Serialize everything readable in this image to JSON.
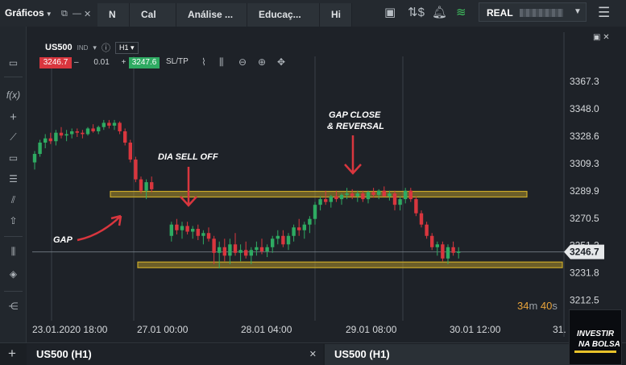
{
  "header": {
    "brand": "Gráficos",
    "tabs": [
      "N",
      "Cal",
      "Análise ...",
      "Educaç...",
      "Hi"
    ],
    "account_mode": "REAL"
  },
  "toolbar": {
    "symbol": "US500",
    "symbol_sub": "IND",
    "timeframe": "H1",
    "sell_price": "3246.7",
    "buy_price": "3247.6",
    "quantity": "0.01",
    "minus": "–",
    "plus": "+",
    "sltp_label": "SL/TP"
  },
  "chart_data": {
    "type": "candlestick",
    "symbol": "US500",
    "timeframe": "H1",
    "y_ticks": [
      3367.3,
      3348.0,
      3328.6,
      3309.3,
      3289.9,
      3270.5,
      3251.2,
      3231.8,
      3212.5
    ],
    "y_tick_labels": [
      "3367.3",
      "3348.0",
      "3328.6",
      "3309.3",
      "3289.9",
      "3270.5",
      "3251.2",
      "3231.8",
      "3212.5"
    ],
    "ylim": [
      3198.0,
      3385.0
    ],
    "current_price": 3246.7,
    "current_price_label": "3246.7",
    "x_labels": [
      "23.01.2020 18:00",
      "27.01 00:00",
      "28.01 04:00",
      "29.01 08:00",
      "30.01 12:00",
      "31."
    ],
    "annotations": [
      "GAP",
      "DIA SELL OFF",
      "GAP CLOSE",
      "& REVERSAL"
    ],
    "zones": [
      {
        "name": "resistance-zone",
        "y": 3287.5
      },
      {
        "name": "support-zone",
        "y": 3237.5
      }
    ],
    "colors": {
      "up": "#2eab62",
      "down": "#d9363e",
      "zone": "#c9a92a",
      "arrow": "#d9363e"
    },
    "candles": [
      [
        3310,
        3318,
        3305,
        3316
      ],
      [
        3316,
        3326,
        3314,
        3324
      ],
      [
        3324,
        3330,
        3320,
        3327
      ],
      [
        3327,
        3331,
        3323,
        3325
      ],
      [
        3325,
        3333,
        3322,
        3331
      ],
      [
        3331,
        3335,
        3327,
        3329
      ],
      [
        3329,
        3333,
        3325,
        3330
      ],
      [
        3330,
        3334,
        3327,
        3332
      ],
      [
        3332,
        3334,
        3328,
        3331
      ],
      [
        3331,
        3333,
        3327,
        3330
      ],
      [
        3330,
        3335,
        3329,
        3334
      ],
      [
        3334,
        3337,
        3331,
        3332
      ],
      [
        3332,
        3336,
        3330,
        3335
      ],
      [
        3335,
        3340,
        3333,
        3338
      ],
      [
        3338,
        3340,
        3334,
        3336
      ],
      [
        3336,
        3340,
        3333,
        3338
      ],
      [
        3338,
        3339,
        3330,
        3332
      ],
      [
        3332,
        3334,
        3322,
        3324
      ],
      [
        3324,
        3326,
        3310,
        3312
      ],
      [
        3312,
        3314,
        3296,
        3298
      ],
      [
        3298,
        3300,
        3288,
        3290
      ],
      [
        3290,
        3298,
        3284,
        3296
      ],
      [
        3296,
        3300,
        3289,
        3291
      ],
      [
        3258,
        3268,
        3254,
        3266
      ],
      [
        3266,
        3270,
        3259,
        3262
      ],
      [
        3262,
        3268,
        3256,
        3265
      ],
      [
        3265,
        3268,
        3259,
        3261
      ],
      [
        3261,
        3265,
        3256,
        3263
      ],
      [
        3263,
        3266,
        3255,
        3258
      ],
      [
        3258,
        3262,
        3252,
        3260
      ],
      [
        3260,
        3264,
        3254,
        3256
      ],
      [
        3256,
        3258,
        3238,
        3246
      ],
      [
        3246,
        3254,
        3235,
        3250
      ],
      [
        3250,
        3256,
        3240,
        3244
      ],
      [
        3244,
        3256,
        3238,
        3252
      ],
      [
        3252,
        3260,
        3244,
        3246
      ],
      [
        3246,
        3252,
        3240,
        3248
      ],
      [
        3248,
        3254,
        3242,
        3244
      ],
      [
        3244,
        3250,
        3238,
        3248
      ],
      [
        3248,
        3254,
        3244,
        3250
      ],
      [
        3250,
        3256,
        3245,
        3247
      ],
      [
        3247,
        3252,
        3243,
        3250
      ],
      [
        3250,
        3258,
        3246,
        3256
      ],
      [
        3256,
        3262,
        3252,
        3258
      ],
      [
        3258,
        3262,
        3250,
        3252
      ],
      [
        3252,
        3260,
        3248,
        3258
      ],
      [
        3258,
        3266,
        3254,
        3264
      ],
      [
        3264,
        3270,
        3258,
        3262
      ],
      [
        3262,
        3268,
        3256,
        3266
      ],
      [
        3266,
        3272,
        3260,
        3270
      ],
      [
        3270,
        3282,
        3266,
        3280
      ],
      [
        3280,
        3286,
        3276,
        3284
      ],
      [
        3284,
        3290,
        3280,
        3282
      ],
      [
        3282,
        3287,
        3278,
        3286
      ],
      [
        3286,
        3290,
        3282,
        3284
      ],
      [
        3284,
        3288,
        3280,
        3287
      ],
      [
        3287,
        3292,
        3284,
        3288
      ],
      [
        3288,
        3291,
        3284,
        3286
      ],
      [
        3286,
        3290,
        3282,
        3288
      ],
      [
        3288,
        3290,
        3282,
        3284
      ],
      [
        3284,
        3290,
        3281,
        3289
      ],
      [
        3289,
        3292,
        3285,
        3287
      ],
      [
        3287,
        3291,
        3284,
        3290
      ],
      [
        3290,
        3293,
        3286,
        3286
      ],
      [
        3286,
        3290,
        3283,
        3288
      ],
      [
        3288,
        3290,
        3276,
        3280
      ],
      [
        3280,
        3286,
        3276,
        3284
      ],
      [
        3284,
        3292,
        3281,
        3290
      ],
      [
        3290,
        3292,
        3282,
        3284
      ],
      [
        3284,
        3286,
        3272,
        3274
      ],
      [
        3274,
        3276,
        3264,
        3266
      ],
      [
        3266,
        3268,
        3256,
        3258
      ],
      [
        3258,
        3260,
        3248,
        3250
      ],
      [
        3250,
        3254,
        3244,
        3252
      ],
      [
        3252,
        3254,
        3240,
        3242
      ],
      [
        3242,
        3252,
        3238,
        3250
      ],
      [
        3250,
        3254,
        3244,
        3246
      ],
      [
        3246,
        3250,
        3242,
        3247
      ]
    ]
  }
}
